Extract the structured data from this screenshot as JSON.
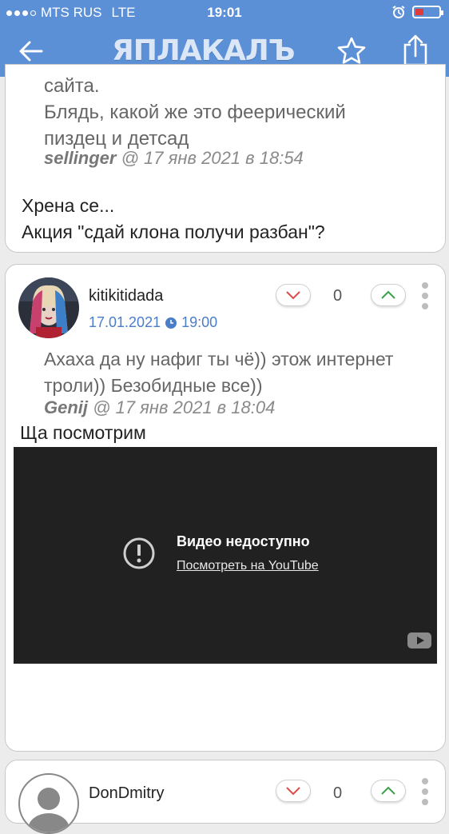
{
  "status_bar": {
    "carrier": "MTS RUS",
    "network": "LTE",
    "time": "19:01"
  },
  "nav": {
    "logo_text": "ЯПЛАКАЛЪ",
    "back_icon": "back-arrow-icon",
    "favorite_icon": "star-icon",
    "share_icon": "share-icon",
    "bar_color": "#5b8fd6"
  },
  "post1": {
    "quote_lines": [
      "сайта.",
      "Блядь, какой же это феерический",
      "пиздец и детсад"
    ],
    "quote_author": "sellinger",
    "quote_meta": "@ 17 янв 2021 в 18:54",
    "text_lines": [
      "Хрена се...",
      "Акция \"сдай клона получи разбан\"?"
    ]
  },
  "post2": {
    "username": "kitikitidada",
    "date": "17.01.2021",
    "time": "19:00",
    "score": "0",
    "quote_lines": [
      "Ахаха да ну нафиг ты чё)) этож интернет",
      "троли)) Безобидные все))"
    ],
    "quote_author": "Genij",
    "quote_meta": "@ 17 янв 2021 в 18:04",
    "text": "Ща посмотрим",
    "video": {
      "title": "Видео недоступно",
      "link": "Посмотреть на YouTube"
    }
  },
  "post3": {
    "username": "DonDmitry",
    "score": "0"
  },
  "colors": {
    "link_blue": "#4a7ec9",
    "downvote_red": "#e04a4a",
    "upvote_green": "#3aa14a"
  }
}
